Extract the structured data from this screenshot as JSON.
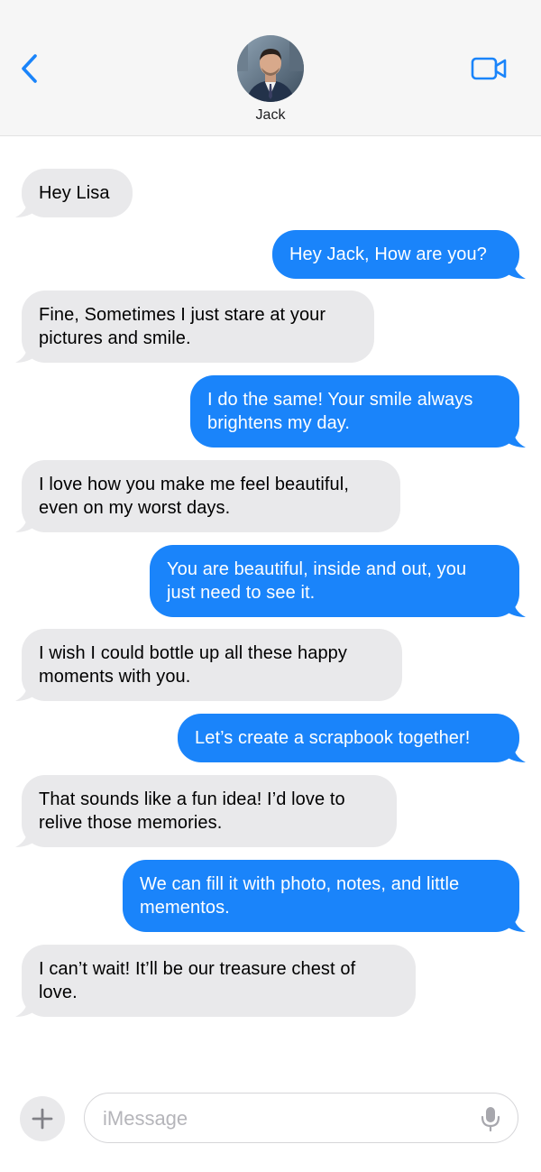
{
  "header": {
    "contact_name": "Jack",
    "back_icon": "chevron-left-icon",
    "video_icon": "video-camera-icon",
    "accent_color": "#1a84fa"
  },
  "messages": [
    {
      "direction": "incoming",
      "lines": [
        "Hey Lisa"
      ]
    },
    {
      "direction": "outgoing",
      "lines": [
        "Hey Jack, How are you?"
      ]
    },
    {
      "direction": "incoming",
      "lines": [
        "Fine, Sometimes I just stare at your",
        "pictures and smile."
      ]
    },
    {
      "direction": "outgoing",
      "lines": [
        "I do the same! Your smile always",
        "brightens my day."
      ]
    },
    {
      "direction": "incoming",
      "lines": [
        "I love how you make me feel beautiful,",
        "even on my worst days."
      ]
    },
    {
      "direction": "outgoing",
      "lines": [
        "You are beautiful, inside and out, you",
        "just need to see it."
      ]
    },
    {
      "direction": "incoming",
      "lines": [
        "I wish I could bottle up all these happy",
        "moments with you."
      ]
    },
    {
      "direction": "outgoing",
      "lines": [
        "Let’s create a scrapbook together!"
      ]
    },
    {
      "direction": "incoming",
      "lines": [
        "That sounds like a fun idea! I’d love to",
        "relive those memories."
      ]
    },
    {
      "direction": "outgoing",
      "lines": [
        "We can fill it with photo, notes, and little",
        "mementos."
      ]
    },
    {
      "direction": "incoming",
      "lines": [
        "I can’t wait! It’ll be our treasure chest of",
        "love."
      ]
    }
  ],
  "input": {
    "placeholder": "iMessage",
    "plus_icon": "plus-icon",
    "mic_icon": "microphone-icon"
  },
  "colors": {
    "incoming_bubble": "#e9e9eb",
    "outgoing_bubble": "#1a84fa",
    "header_bg": "#f6f6f6"
  }
}
